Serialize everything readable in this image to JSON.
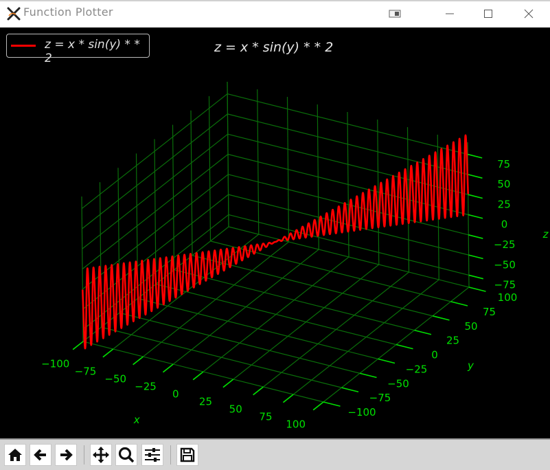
{
  "window": {
    "title": "Function Plotter",
    "icons": {
      "app": "x-logo-icon",
      "extra": "window-snap-icon",
      "minimize": "minimize-icon",
      "maximize": "maximize-icon",
      "close": "close-icon"
    }
  },
  "legend": {
    "label": "z = x * sin(y) * * 2",
    "color": "#ff0000"
  },
  "toolbar": {
    "buttons": [
      {
        "name": "home",
        "icon": "home-icon"
      },
      {
        "name": "back",
        "icon": "arrow-left-icon"
      },
      {
        "name": "forward",
        "icon": "arrow-right-icon"
      },
      {
        "name": "pan",
        "icon": "move-icon"
      },
      {
        "name": "zoom",
        "icon": "magnifier-icon"
      },
      {
        "name": "configure-subplots",
        "icon": "sliders-icon"
      },
      {
        "name": "save",
        "icon": "floppy-disk-icon"
      }
    ]
  },
  "colors": {
    "background": "#000000",
    "grid": "#0a6e0a",
    "ticks": "#00e000",
    "line": "#ff0000",
    "title": "#e6e6e6"
  },
  "chart_data": {
    "type": "line",
    "projection": "3d",
    "title": "z = x * sin(y) * * 2",
    "function": "z = x * sin(y)**2",
    "xlabel": "x",
    "ylabel": "y",
    "zlabel": "z",
    "xlim": [
      -100,
      100
    ],
    "ylim": [
      -100,
      100
    ],
    "zlim": [
      -90,
      90
    ],
    "xticks": [
      -100,
      -75,
      -50,
      -25,
      0,
      25,
      50,
      75,
      100
    ],
    "yticks": [
      -100,
      -75,
      -50,
      -25,
      0,
      25,
      50,
      75,
      100
    ],
    "zticks": [
      -75,
      -50,
      -25,
      0,
      25,
      50,
      75
    ],
    "xtick_labels": [
      "−100",
      "−75",
      "−50",
      "−25",
      "0",
      "25",
      "50",
      "75",
      "100"
    ],
    "ytick_labels": [
      "−100",
      "−75",
      "−50",
      "−25",
      "0",
      "25",
      "50",
      "75",
      "100"
    ],
    "ztick_labels": [
      "−75",
      "−50",
      "−25",
      "0",
      "25",
      "50",
      "75"
    ],
    "grid": true,
    "legend_position": "top-left",
    "series": [
      {
        "name": "z = x * sin(y) * * 2",
        "color": "#ff0000",
        "parametric": "x = t, y = t, z = t * sin(t)^2",
        "t_range": [
          -100,
          100
        ],
        "z_envelope": [
          -100,
          100
        ]
      }
    ]
  }
}
